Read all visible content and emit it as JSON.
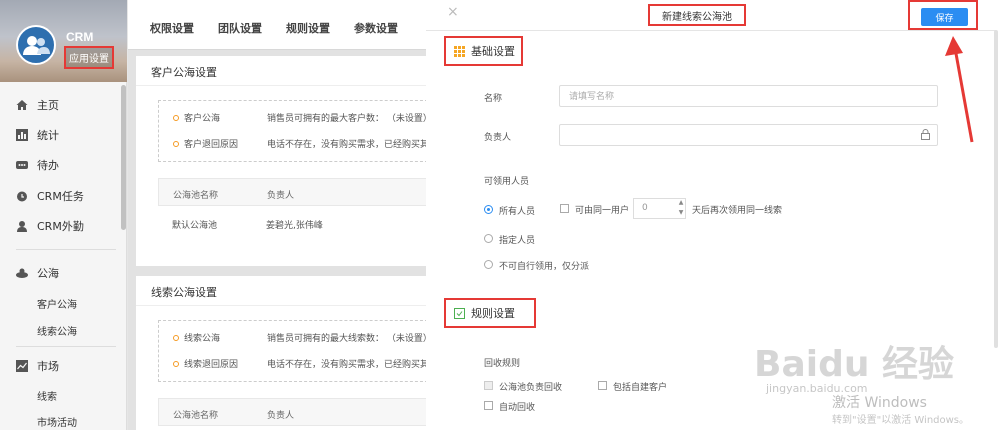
{
  "sidebar": {
    "app_name": "CRM",
    "app_settings": "应用设置",
    "items": [
      {
        "label": "主页",
        "icon": "home-icon"
      },
      {
        "label": "统计",
        "icon": "bar-chart-icon"
      },
      {
        "label": "待办",
        "icon": "chat-icon"
      },
      {
        "label": "CRM任务",
        "icon": "alarm-icon"
      },
      {
        "label": "CRM外勤",
        "icon": "user-pin-icon"
      },
      {
        "label": "公海",
        "icon": "pool-icon"
      },
      {
        "label": "市场",
        "icon": "trend-icon"
      }
    ],
    "pool_subs": [
      "客户公海",
      "线索公海"
    ],
    "market_subs": [
      "线索",
      "市场活动"
    ]
  },
  "tabs": [
    "权限设置",
    "团队设置",
    "规则设置",
    "参数设置"
  ],
  "customer_pool": {
    "title": "客户公海设置",
    "rules": [
      {
        "name": "客户公海",
        "desc": "销售员可拥有的最大客户数：  （未设置）"
      },
      {
        "name": "客户退回原因",
        "desc": "电话不存在，没有购买需求，已经购买其"
      }
    ],
    "table_headers": [
      "公海池名称",
      "负责人"
    ],
    "rows": [
      {
        "name": "默认公海池",
        "owner": "姜碧光,张伟峰"
      }
    ]
  },
  "lead_pool": {
    "title": "线索公海设置",
    "rules": [
      {
        "name": "线索公海",
        "desc": "销售员可拥有的最大线索数：  （未设置）"
      },
      {
        "name": "线索退回原因",
        "desc": "电话不存在，没有购买需求，已经购买其"
      }
    ],
    "table_headers": [
      "公海池名称",
      "负责人"
    ]
  },
  "panel": {
    "close": "×",
    "title": "新建线索公海池",
    "save": "保存",
    "basic_section": "基础设置",
    "name_label": "名称",
    "name_placeholder": "请填写名称",
    "owner_label": "负责人",
    "lock_icon": "lock-icon",
    "claimers_label": "可领用人员",
    "radio_all": "所有人员",
    "same_user_label": "可由同一用户",
    "days_value": "0",
    "days_suffix": "天后再次领用同一线索",
    "radio_specified": "指定人员",
    "radio_none": "不可自行领用，仅分派",
    "rules_section": "规则设置",
    "recycle_label": "回收规则",
    "chk_owner_recycle": "公海池负责回收",
    "chk_include_self": "包括自建客户",
    "chk_auto_recycle": "自动回收"
  },
  "watermark": {
    "line1": "激活 Windows",
    "line2": "转到\"设置\"以激活 Windows。",
    "baidu": "Baidu 经验",
    "baidu_url": "jingyan.baidu.com"
  },
  "colors": {
    "accent": "#2b8df2",
    "highlight": "#e53935",
    "dot": "#f59a23"
  }
}
